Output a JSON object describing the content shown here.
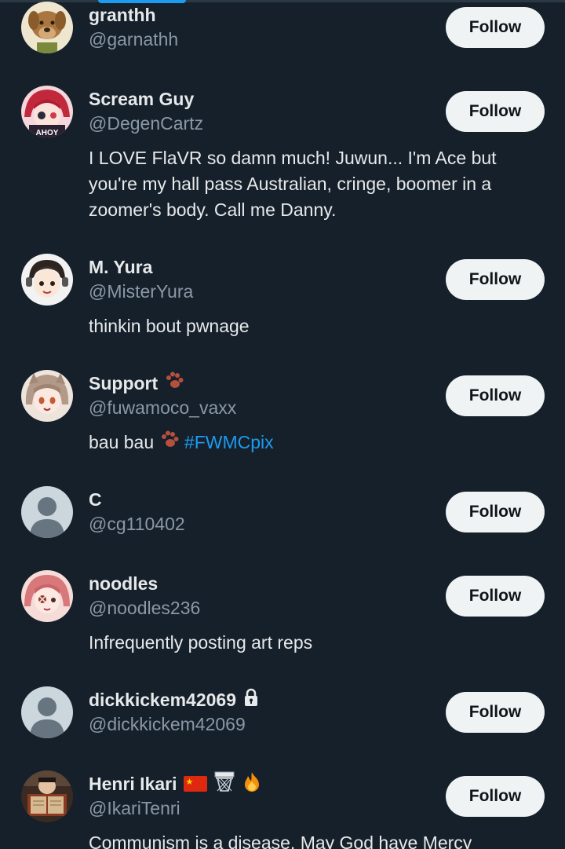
{
  "follow_label": "Follow",
  "colors": {
    "background": "#15202b",
    "primary_text": "#e7e9ea",
    "secondary_text": "#8b98a5",
    "link": "#1d9bf0",
    "button_bg": "#eff3f4",
    "button_text": "#0f1419"
  },
  "users": [
    {
      "name": "granthh",
      "handle": "@garnathh",
      "bio": "",
      "avatar": "dog-avatar"
    },
    {
      "name": "Scream Guy",
      "handle": "@DegenCartz",
      "bio": "I LOVE FlaVR so damn much! Juwun... I'm Ace but you're my hall pass Australian, cringe, boomer in a zoomer's body. Call me Danny.",
      "avatar": "anime-avatar",
      "avatar_text": "AHOY"
    },
    {
      "name": "M. Yura",
      "handle": "@MisterYura",
      "bio": "thinkin bout pwnage",
      "avatar": "anime-avatar"
    },
    {
      "name": "Support",
      "handle": "@fuwamoco_vaxx",
      "bio": "bau bau",
      "hashtag": "#FWMCpix",
      "avatar": "anime-avatar",
      "name_icon": "paw-icon"
    },
    {
      "name": "C",
      "handle": "@cg110402",
      "bio": "",
      "avatar": "default-avatar"
    },
    {
      "name": "noodles",
      "handle": "@noodles236",
      "bio": "Infrequently posting art reps",
      "avatar": "anime-avatar"
    },
    {
      "name": "dickkickem42069",
      "handle": "@dickkickem42069",
      "bio": "",
      "avatar": "default-avatar",
      "name_icon": "lock-icon"
    },
    {
      "name": "Henri Ikari",
      "handle": "@IkariTenri",
      "bio": "Communism is a disease. May God have Mercy",
      "avatar": "reader-avatar",
      "name_icons": [
        "china-flag-icon",
        "basketball-hoop-icon",
        "fire-icon"
      ]
    }
  ]
}
